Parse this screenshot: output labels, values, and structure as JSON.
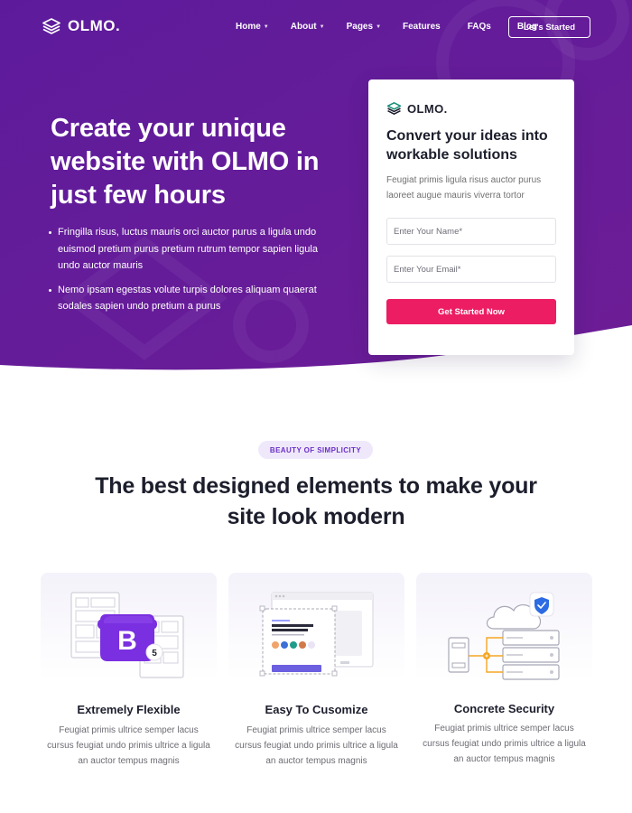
{
  "brand": {
    "name": "OLMO."
  },
  "nav": {
    "items": [
      {
        "label": "Home",
        "has_dropdown": true
      },
      {
        "label": "About",
        "has_dropdown": true
      },
      {
        "label": "Pages",
        "has_dropdown": true
      },
      {
        "label": "Features",
        "has_dropdown": false
      },
      {
        "label": "FAQs",
        "has_dropdown": false
      },
      {
        "label": "Blog",
        "has_dropdown": false
      }
    ],
    "cta_label": "Let's Started"
  },
  "hero": {
    "title": "Create your unique website with OLMO in just few hours",
    "bullets": [
      "Fringilla risus, luctus mauris orci auctor purus a ligula undo euismod pretium purus pretium rutrum tempor sapien ligula undo auctor mauris",
      "Nemo ipsam egestas volute turpis dolores aliquam quaerat sodales sapien undo pretium a purus"
    ]
  },
  "form": {
    "brand": "OLMO.",
    "title": "Convert your ideas into workable solutions",
    "description": "Feugiat primis ligula risus auctor purus laoreet augue mauris viverra tortor",
    "name_placeholder": "Enter Your Name*",
    "email_placeholder": "Enter Your Email*",
    "submit_label": "Get Started Now"
  },
  "features": {
    "badge": "BEAUTY OF SIMPLICITY",
    "title": "The best designed elements to make your site look modern",
    "cards": [
      {
        "title": "Extremely Flexible",
        "description": "Feugiat primis ultrice semper lacus cursus feugiat undo primis ultrice a ligula an auctor tempus magnis",
        "illustration_text": [
          "B",
          "5"
        ]
      },
      {
        "title": "Easy To Cusomize",
        "description": "Feugiat primis ultrice semper lacus cursus feugiat undo primis ultrice a ligula an auctor tempus magnis"
      },
      {
        "title": "Concrete Security",
        "description": "Feugiat primis ultrice semper lacus cursus feugiat undo primis ultrice a ligula an auctor tempus magnis"
      }
    ]
  },
  "colors": {
    "hero_purple": "#5c1a9a",
    "accent_pink": "#ec1d63",
    "badge_bg": "#efe8fb",
    "badge_text": "#6a30c5",
    "security_blue": "#2d6be4",
    "connector_orange": "#f5a623"
  },
  "icons": {
    "logo": "layers-icon",
    "nav_caret": "chevron-down-icon",
    "security": "shield-check-icon",
    "cloud": "cloud-icon"
  }
}
